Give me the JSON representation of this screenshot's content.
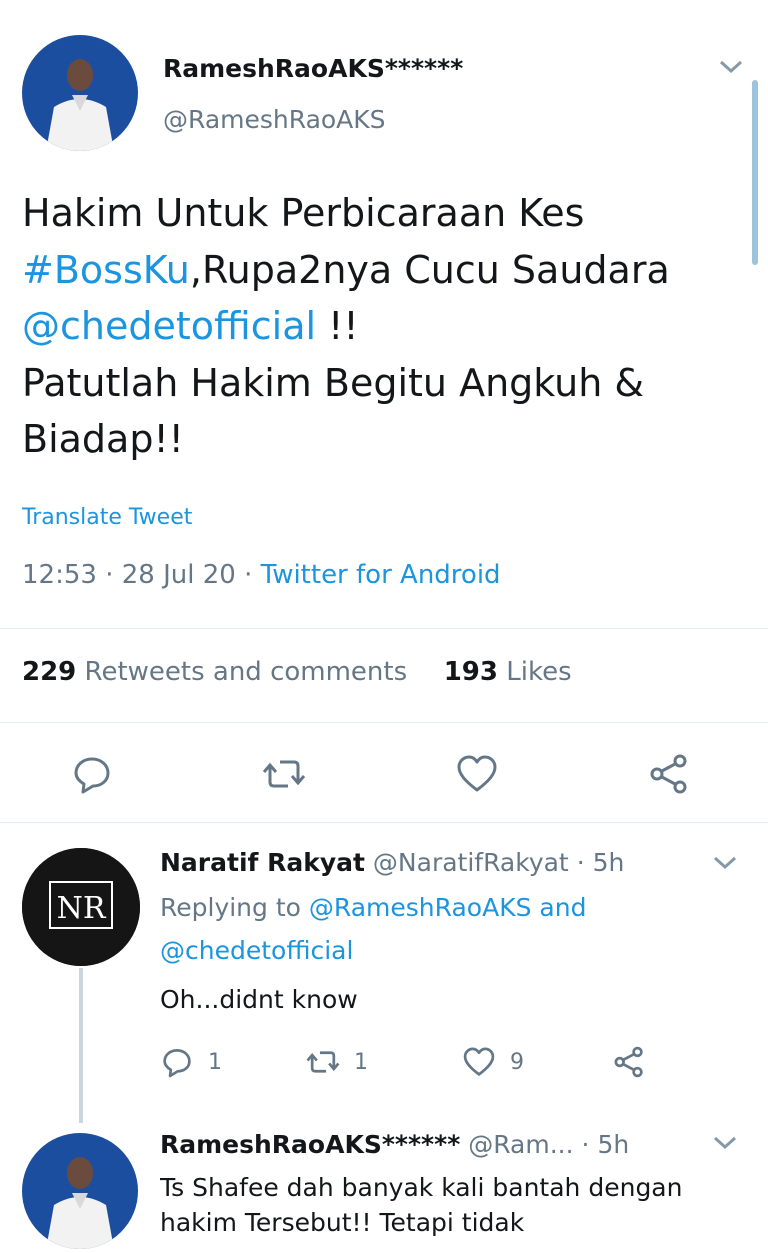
{
  "tweet": {
    "display_name": "RameshRaoAKS******",
    "handle": "@RameshRaoAKS",
    "text_lines": [
      "Hakim Untuk Perbicaraan Kes",
      ",Rupa2nya Cucu Saudara",
      " !!",
      "Patutlah Hakim Begitu Angkuh &",
      "Biadap!!"
    ],
    "hashtag": "#BossKu",
    "mention": "@chedetofficial",
    "translate_label": "Translate Tweet",
    "time": "12:53",
    "date": "28 Jul 20",
    "source": "Twitter for Android",
    "retweets_count": "229",
    "retweets_label": "Retweets and comments",
    "likes_count": "193",
    "likes_label": "Likes"
  },
  "actions": {
    "reply_icon": "reply-icon",
    "retweet_icon": "retweet-icon",
    "like_icon": "heart-icon",
    "share_icon": "share-icon"
  },
  "replies": [
    {
      "display_name": "Naratif Rakyat",
      "handle": "@NaratifRakyat",
      "age": "5h",
      "replying_prefix": "Replying to",
      "replying_to_1": "@RameshRaoAKS",
      "replying_and": "and",
      "replying_to_2": "@chedetofficial",
      "text": "Oh...didnt know",
      "reply_count": "1",
      "retweet_count": "1",
      "like_count": "9",
      "avatar_text": "NR"
    },
    {
      "display_name": "RameshRaoAKS******",
      "handle": "@Ram...",
      "age": "5h",
      "text": "Ts Shafee dah banyak kali bantah dengan hakim Tersebut!! Tetapi tidak"
    }
  ],
  "colors": {
    "link": "#1b95e0",
    "secondary_text": "#657786",
    "primary_text": "#14171a",
    "divider": "#e6ecf0"
  }
}
